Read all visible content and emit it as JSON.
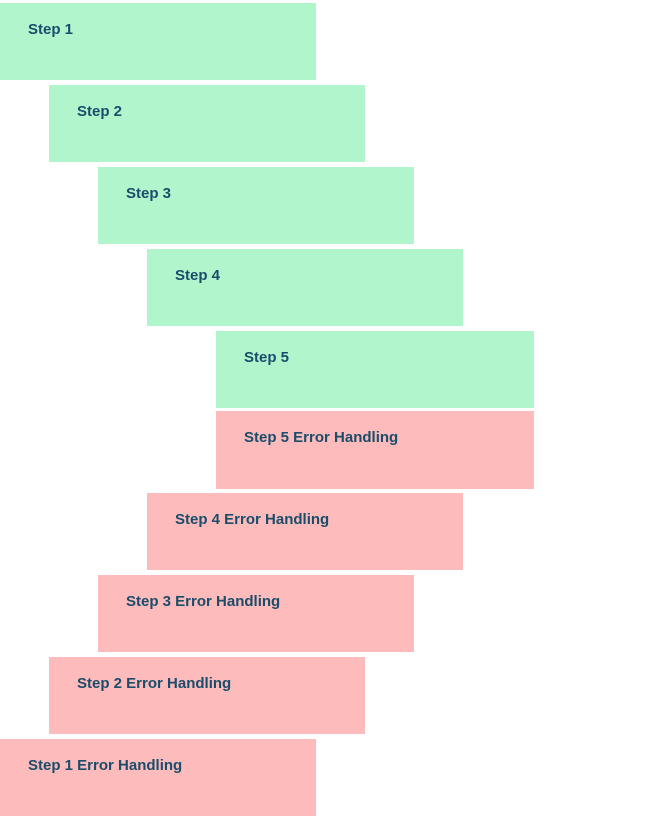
{
  "blocks": [
    {
      "label": "Step 1",
      "type": "step"
    },
    {
      "label": "Step 2",
      "type": "step"
    },
    {
      "label": "Step 3",
      "type": "step"
    },
    {
      "label": "Step 4",
      "type": "step"
    },
    {
      "label": "Step 5",
      "type": "step"
    },
    {
      "label": "Step 5 Error Handling",
      "type": "error"
    },
    {
      "label": "Step 4 Error Handling",
      "type": "error"
    },
    {
      "label": "Step 3 Error Handling",
      "type": "error"
    },
    {
      "label": "Step 2 Error Handling",
      "type": "error"
    },
    {
      "label": "Step 1 Error Handling",
      "type": "error"
    }
  ],
  "colors": {
    "step_bg": "#b1f5cd",
    "error_bg": "#fdbbbb",
    "text": "#1a4d6b"
  }
}
